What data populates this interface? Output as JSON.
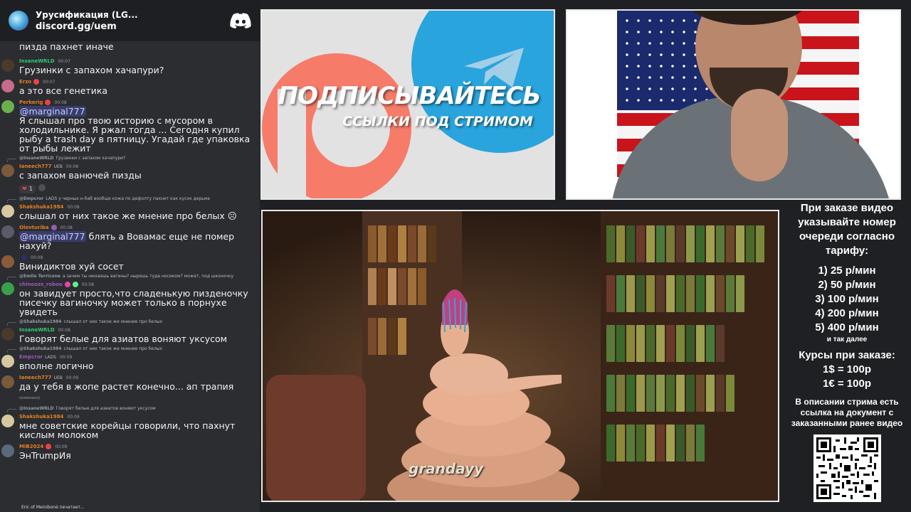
{
  "colors": {
    "background": "#1f2023",
    "chat_bg": "#2b2d31",
    "patreon": "#f96854",
    "telegram": "#2aa4dd",
    "mention": "#c9cdfb"
  },
  "chat": {
    "server_name": "Урусификация (LG...",
    "server_link": "discord.gg/uem",
    "first_line": "пизда пахнет иначе",
    "messages": {
      "m1": {
        "user": "InsaneWRLD",
        "time": "00:07",
        "text": "Грузинки с запахом хачапури?"
      },
      "m2": {
        "user": "Erzo",
        "time": "00:07",
        "text": "а это все генетика"
      },
      "m3": {
        "user": "Perkerig",
        "time": "00:08",
        "mention": "@marginal777",
        "text": "Я слышал про твою историю с мусором в холодильнике. Я ржал тогда ... Сегодня купил рыбу а trash day в пятницу. Угадай где упаковка от рыбы лежит"
      },
      "m4": {
        "reply_user": "@InsaneWRLD",
        "reply_text": "Грузинки с запахом хачапури?",
        "user": "Ianeech777",
        "badge": "UEB",
        "time": "00:08",
        "text": "с запахом ванючей пизды",
        "reaction_count": "1"
      },
      "m5": {
        "reply_user": "@Empcror",
        "reply_badge": "LADS",
        "reply_text": "у черных н-баб вообще кожа по дефолту пахнет как кусок дерьма",
        "user": "Shakshuka1984",
        "time": "00:08",
        "text": "слышал от них такое же мнение про белых"
      },
      "m6": {
        "user": "Olevturiba",
        "time": "00:08",
        "mention": "@marginal777",
        "text": "блять а Вовамас еще не помер нахуй?"
      },
      "m7": {
        "user": "",
        "time": "00:08",
        "text": "Винидиктов хуй сосет"
      },
      "m8": {
        "reply_user": "@Emile Terricone",
        "reply_text": "а зачем ты нюхаешь вагины? нырешь туда носиком? может, под шконочку",
        "user": "chinoozs_roboo",
        "time": "00:08",
        "text": "он завидует просто,что сладенькую пизденочку писечку вагиночку может только в порнухе увидеть"
      },
      "m9": {
        "reply_user": "@Shakshuka1984",
        "reply_text": "слышал от них такое же мнение про белых",
        "user": "InsaneWRLD",
        "time": "00:08",
        "text": "Говорят белые для азиатов воняют уксусом"
      },
      "m10": {
        "reply_user": "@Shakshuka1984",
        "reply_text": "слышал от них такое же мнение про белых",
        "user": "Empcror",
        "badge": "LADS",
        "time": "00:09",
        "text": "вполне логично"
      },
      "m11": {
        "user": "Ianeech777",
        "badge": "UEB",
        "time": "00:09",
        "text": "да у тебя в жопе растет конечно... ап трапия",
        "edited": "(изменено)"
      },
      "m12": {
        "reply_user": "@InsaneWRLD",
        "reply_text": "Говорят белые для азиатов воняют уксусом",
        "user": "Shakshuka1984",
        "time": "00:09",
        "text": "мне советские корейцы говорили, что пахнут кислым молоком"
      },
      "m13": {
        "user": "MiB2024",
        "time": "00:09",
        "text": "ЭнTrumpИя"
      }
    },
    "typing": "Eric of Meinibonė печатает..."
  },
  "promo": {
    "title": "ПОДПИСЫВАЙТЕСЬ",
    "subtitle": "ССЫЛКИ ПОД СТРИМОМ",
    "icons": [
      "patreon-logo",
      "telegram-logo"
    ]
  },
  "video": {
    "watermark": "grandayy"
  },
  "info": {
    "heading": "При заказе видео указывайте номер очереди согласно тарифу:",
    "rates": [
      "1) 25 р/мин",
      "2) 50 р/мин",
      "3) 100 р/мин",
      "4) 200 р/мин",
      "5) 400 р/мин"
    ],
    "etc": "и так далее",
    "currency_heading": "Курсы при заказе:",
    "currency": [
      "1$ = 100р",
      "1€ = 100р"
    ],
    "description": "В описании стрима есть ссылка на документ с заказанными ранее видео"
  }
}
